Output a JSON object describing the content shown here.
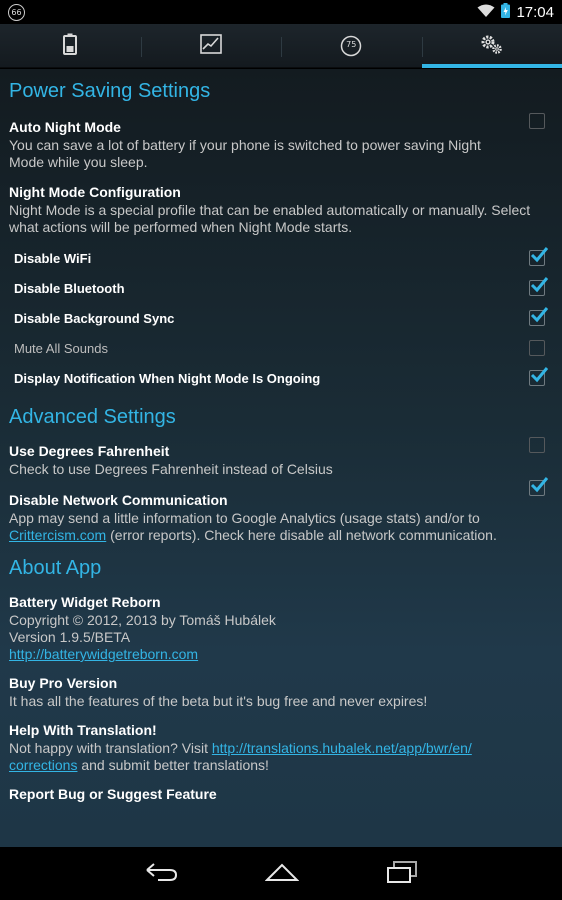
{
  "status": {
    "notif_badge": "66",
    "time": "17:04"
  },
  "tabs": [
    {
      "icon": "battery-icon"
    },
    {
      "icon": "graph-icon"
    },
    {
      "icon": "gauge-icon",
      "badge": "75"
    },
    {
      "icon": "gears-icon",
      "active": true
    }
  ],
  "power": {
    "title": "Power Saving Settings",
    "auto_night": {
      "title": "Auto Night Mode",
      "summary": "You can save a lot of battery if your phone is switched to power saving Night Mode while you sleep.",
      "checked": false
    },
    "night_config": {
      "title": "Night Mode Configuration",
      "summary": "Night Mode is a special profile that can be enabled automatically or manually. Select what actions will be performed when Night Mode starts."
    },
    "options": [
      {
        "label": "Disable WiFi",
        "checked": true
      },
      {
        "label": "Disable Bluetooth",
        "checked": true
      },
      {
        "label": "Disable Background Sync",
        "checked": true
      },
      {
        "label": "Mute All Sounds",
        "checked": false
      },
      {
        "label": "Display Notification When Night Mode Is Ongoing",
        "checked": true
      }
    ]
  },
  "advanced": {
    "title": "Advanced Settings",
    "fahrenheit": {
      "title": "Use Degrees Fahrenheit",
      "summary": "Check to use Degrees Fahrenheit instead of Celsius",
      "checked": false
    },
    "network": {
      "title": "Disable Network Communication",
      "summary_pre": "App may send a little information to Google Analytics (usage stats) and/or to ",
      "link": "Crittercism.com",
      "summary_post": " (error reports). Check here disable all network communication.",
      "checked": true
    }
  },
  "about": {
    "title": "About App",
    "app": {
      "title": "Battery Widget Reborn",
      "line1": "Copyright © 2012, 2013 by Tomáš Hubálek",
      "line2": "Version 1.9.5/BETA",
      "link": "http://batterywidgetreborn.com"
    },
    "pro": {
      "title": "Buy Pro Version",
      "summary": "It has all the features of the beta but it's bug free and never expires!"
    },
    "translation": {
      "title": "Help With Translation!",
      "summary_pre": "Not happy with translation? Visit ",
      "link1": "http://translations.hubalek.net/app/bwr/en/",
      "link2": "corrections",
      "summary_post": " and submit better translations!"
    },
    "bug": {
      "title": "Report Bug or Suggest Feature"
    }
  },
  "colors": {
    "accent": "#33b5e5"
  }
}
